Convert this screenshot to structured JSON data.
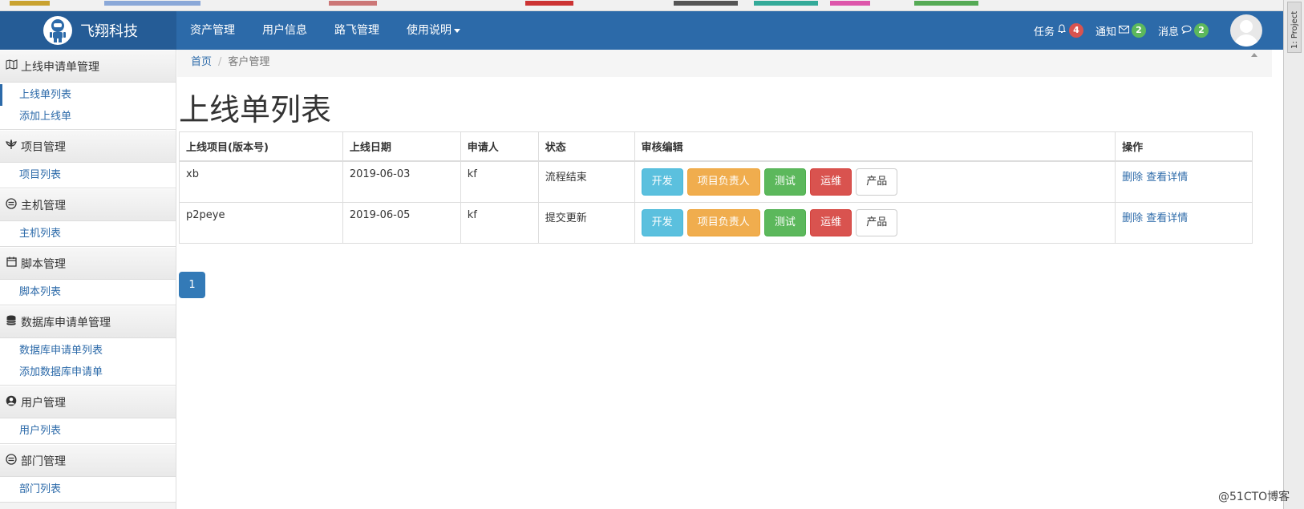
{
  "brand": {
    "name": "飞翔科技"
  },
  "nav": {
    "items": [
      {
        "label": "资产管理"
      },
      {
        "label": "用户信息"
      },
      {
        "label": "路飞管理"
      },
      {
        "label": "使用说明"
      }
    ]
  },
  "right_nav": {
    "tasks": {
      "label": "任务",
      "count": "4",
      "icon": "bell-icon"
    },
    "notices": {
      "label": "通知",
      "count": "2",
      "icon": "envelope-icon"
    },
    "messages": {
      "label": "消息",
      "count": "2",
      "icon": "comment-icon"
    }
  },
  "sidebar": {
    "groups": [
      {
        "label": "上线申请单管理",
        "icon": "map-icon",
        "items": [
          "上线单列表",
          "添加上线单"
        ]
      },
      {
        "label": "项目管理",
        "icon": "plant-icon",
        "items": [
          "项目列表"
        ]
      },
      {
        "label": "主机管理",
        "icon": "server-icon",
        "items": [
          "主机列表"
        ]
      },
      {
        "label": "脚本管理",
        "icon": "calendar-icon",
        "items": [
          "脚本列表"
        ]
      },
      {
        "label": "数据库申请单管理",
        "icon": "database-icon",
        "items": [
          "数据库申请单列表",
          "添加数据库申请单"
        ]
      },
      {
        "label": "用户管理",
        "icon": "user-icon",
        "items": [
          "用户列表"
        ]
      },
      {
        "label": "部门管理",
        "icon": "server-icon",
        "items": [
          "部门列表"
        ]
      }
    ]
  },
  "breadcrumb": {
    "home": "首页",
    "current": "客户管理"
  },
  "page": {
    "title": "上线单列表"
  },
  "table": {
    "headers": [
      "上线项目(版本号)",
      "上线日期",
      "申请人",
      "状态",
      "审核编辑",
      "操作"
    ],
    "rows": [
      {
        "project": "xb",
        "date": "2019-06-03",
        "applicant": "kf",
        "status": "流程结束"
      },
      {
        "project": "p2peye",
        "date": "2019-06-05",
        "applicant": "kf",
        "status": "提交更新"
      }
    ],
    "review_buttons": [
      "开发",
      "项目负责人",
      "测试",
      "运维",
      "产品"
    ],
    "actions": {
      "delete": "删除",
      "detail": "查看详情"
    }
  },
  "pagination": {
    "current": "1"
  },
  "ide": {
    "tab": "1: Project"
  },
  "watermark": "@51CTO博客",
  "colors": {
    "primary": "#2c6aa9",
    "info": "#5bc0de",
    "warning": "#f0ad4e",
    "success": "#5cb85c",
    "danger": "#d9534f"
  }
}
